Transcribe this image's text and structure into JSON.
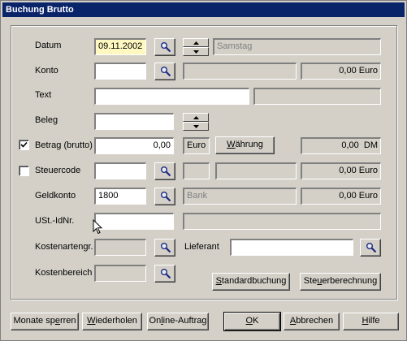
{
  "window": {
    "title": "Buchung Brutto"
  },
  "datum": {
    "label": "Datum",
    "value": "09.11.2002",
    "weekday": "Samstag"
  },
  "konto": {
    "label": "Konto",
    "value": "",
    "name": "",
    "amount": "0,00 Euro"
  },
  "text": {
    "label": "Text",
    "value": "",
    "extra": ""
  },
  "beleg": {
    "label": "Beleg",
    "value": ""
  },
  "betrag": {
    "label": "Betrag (brutto)",
    "checked": true,
    "value": "0,00",
    "currency": "Euro",
    "waehrung_button_pre": "",
    "waehrung_button_u": "W",
    "waehrung_button_post": "ährung",
    "converted": "0,00  DM"
  },
  "steuercode": {
    "label": "Steuercode",
    "checked": false,
    "value": "",
    "code": "",
    "description": "",
    "amount": "0,00 Euro"
  },
  "geldkonto": {
    "label": "Geldkonto",
    "value": "1800",
    "name": "Bank",
    "amount": "0,00 Euro"
  },
  "ustid": {
    "label": "USt.-IdNr.",
    "value": "",
    "info": ""
  },
  "kostenartengr": {
    "label": "Kostenartengr.",
    "value": ""
  },
  "lieferant": {
    "label": "Lieferant",
    "value": ""
  },
  "kostenbereich": {
    "label": "Kostenbereich",
    "value": ""
  },
  "buttons": {
    "standardbuchung": {
      "pre": "",
      "u": "S",
      "post": "tandardbuchung"
    },
    "steuerberechnung": {
      "pre": "Ste",
      "u": "u",
      "post": "erberechnung"
    },
    "monate_sperren": {
      "pre": "Monate sp",
      "u": "e",
      "post": "rren"
    },
    "wiederholen": {
      "pre": "",
      "u": "W",
      "post": "iederholen"
    },
    "online_auftrag": {
      "pre": "On",
      "u": "l",
      "post": "ine-Auftrag"
    },
    "ok": {
      "pre": "",
      "u": "O",
      "post": "K"
    },
    "abbrechen": {
      "pre": "",
      "u": "A",
      "post": "bbrechen"
    },
    "hilfe": {
      "pre": "",
      "u": "H",
      "post": "ilfe"
    }
  },
  "icons": {
    "lookup": "magnifier-icon",
    "spinner": "spinner-arrows",
    "checkmark": "checkmark-icon",
    "cursor": "mouse-cursor-icon"
  },
  "colors": {
    "titlebar": "#0a246a",
    "face": "#d4d0c8",
    "datum_highlight": "#fff8c0"
  }
}
